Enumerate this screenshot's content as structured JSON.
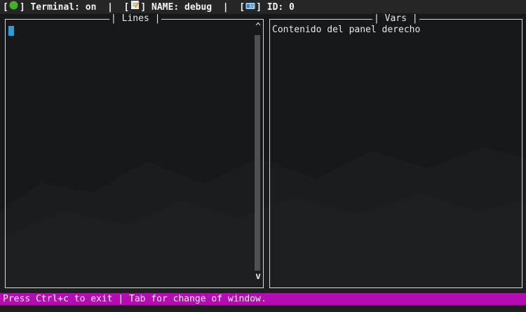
{
  "topbar": {
    "terminal_label": "Terminal: on",
    "name_label": "NAME: debug",
    "id_label": "ID: 0",
    "separator": "|",
    "icons": [
      "green-circle-icon",
      "memo-icon",
      "id-card-icon"
    ]
  },
  "left_panel": {
    "title": "| Lines |",
    "scroll_up": "^",
    "scroll_down": "v"
  },
  "right_panel": {
    "title": "| Vars |",
    "content": "Contenido del panel derecho"
  },
  "statusbar": {
    "text": "Press Ctrl+c to exit | Tab for change of window."
  },
  "colors": {
    "background": "#17181a",
    "topbar": "#262626",
    "statusbar": "#b20cb2",
    "cursor": "#2aa0d8",
    "accent": "#3aa0e8"
  }
}
